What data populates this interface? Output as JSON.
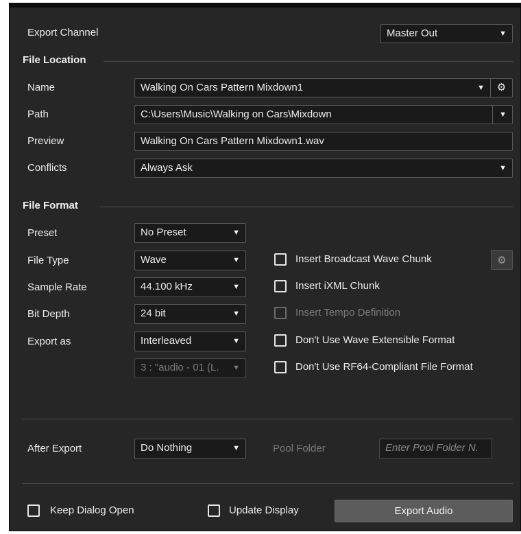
{
  "export_channel": {
    "label": "Export Channel",
    "value": "Master Out"
  },
  "file_location": {
    "heading": "File Location",
    "name_label": "Name",
    "name_value": "Walking On Cars Pattern Mixdown1",
    "path_label": "Path",
    "path_value": "C:\\Users\\Music\\Walking on Cars\\Mixdown",
    "preview_label": "Preview",
    "preview_value": "Walking On Cars Pattern Mixdown1.wav",
    "conflicts_label": "Conflicts",
    "conflicts_value": "Always Ask"
  },
  "file_format": {
    "heading": "File Format",
    "preset_label": "Preset",
    "preset_value": "No Preset",
    "file_type_label": "File Type",
    "file_type_value": "Wave",
    "sample_rate_label": "Sample Rate",
    "sample_rate_value": "44.100 kHz",
    "bit_depth_label": "Bit Depth",
    "bit_depth_value": "24 bit",
    "export_as_label": "Export as",
    "export_as_value": "Interleaved",
    "channel_select_value": "3 : \"audio - 01 (L.",
    "options": [
      {
        "label": "Insert Broadcast Wave Chunk",
        "checked": false,
        "enabled": true
      },
      {
        "label": "Insert iXML Chunk",
        "checked": false,
        "enabled": true
      },
      {
        "label": "Insert Tempo Definition",
        "checked": false,
        "enabled": false
      },
      {
        "label": "Don't Use Wave Extensible Format",
        "checked": false,
        "enabled": true
      },
      {
        "label": "Don't Use RF64-Compliant File Format",
        "checked": false,
        "enabled": true
      }
    ]
  },
  "after_export": {
    "label": "After Export",
    "value": "Do Nothing",
    "pool_folder_label": "Pool Folder",
    "pool_folder_placeholder": "Enter Pool Folder N."
  },
  "footer": {
    "keep_dialog_open": "Keep Dialog Open",
    "update_display": "Update Display",
    "export_button": "Export Audio"
  },
  "icons": {
    "dropdown": "▼",
    "gear": "⚙"
  },
  "colors": {
    "panel_bg": "#262626",
    "field_bg": "#1a1a1a",
    "button_bg": "#5c5c5c"
  }
}
